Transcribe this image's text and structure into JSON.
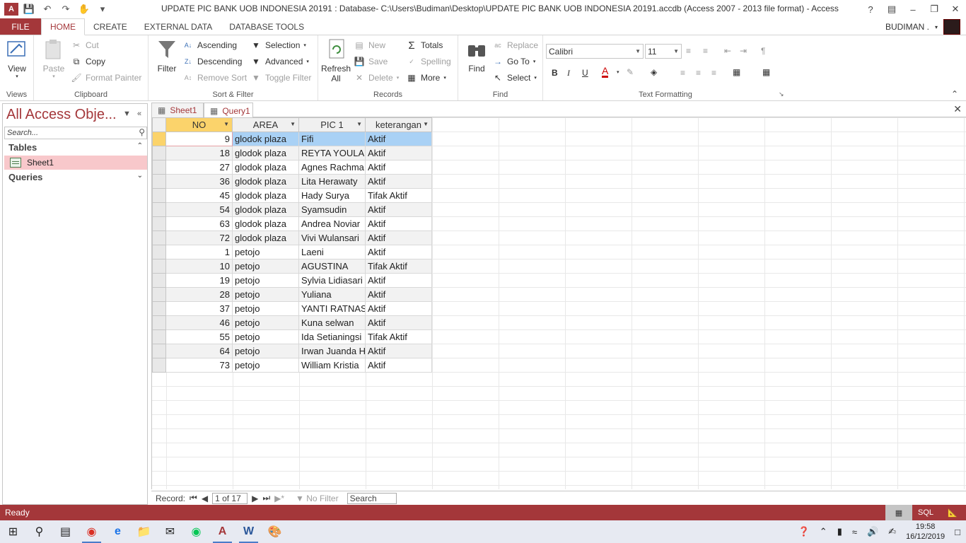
{
  "window": {
    "title": "UPDATE PIC BANK UOB INDONESIA 20191 : Database- C:\\Users\\Budiman\\Desktop\\UPDATE PIC BANK UOB INDONESIA 20191.accdb (Access 2007 - 2013 file format) - Access",
    "help": "?",
    "user": "BUDIMAN ."
  },
  "tabs": [
    "FILE",
    "HOME",
    "CREATE",
    "EXTERNAL DATA",
    "DATABASE TOOLS"
  ],
  "ribbon": {
    "views": {
      "label": "Views",
      "view": "View"
    },
    "clipboard": {
      "label": "Clipboard",
      "paste": "Paste",
      "cut": "Cut",
      "copy": "Copy",
      "format_painter": "Format Painter"
    },
    "sort_filter": {
      "label": "Sort & Filter",
      "filter": "Filter",
      "ascending": "Ascending",
      "descending": "Descending",
      "remove_sort": "Remove Sort",
      "selection": "Selection",
      "advanced": "Advanced",
      "toggle_filter": "Toggle Filter"
    },
    "records": {
      "label": "Records",
      "refresh": "Refresh",
      "refresh_sub": "All",
      "new": "New",
      "save": "Save",
      "delete": "Delete",
      "totals": "Totals",
      "spelling": "Spelling",
      "more": "More"
    },
    "find": {
      "label": "Find",
      "find": "Find",
      "replace": "Replace",
      "goto": "Go To",
      "select": "Select"
    },
    "text_formatting": {
      "label": "Text Formatting",
      "font": "Calibri",
      "size": "11",
      "bold": "B",
      "italic": "I",
      "underline": "U"
    }
  },
  "nav": {
    "title": "All Access Obje...",
    "search_placeholder": "Search...",
    "sections": [
      {
        "label": "Tables",
        "items": [
          "Sheet1"
        ]
      },
      {
        "label": "Queries",
        "items": []
      }
    ]
  },
  "doc_tabs": [
    "Sheet1",
    "Query1"
  ],
  "datasheet": {
    "columns": [
      "NO",
      "AREA",
      "PIC 1",
      "keterangan"
    ],
    "rows": [
      [
        "9",
        "glodok plaza",
        "Fifi",
        "Aktif"
      ],
      [
        "18",
        "glodok plaza",
        "REYTA YOULA H",
        "Aktif"
      ],
      [
        "27",
        "glodok plaza",
        "Agnes Rachma",
        "Aktif"
      ],
      [
        "36",
        "glodok plaza",
        "Lita Herawaty",
        "Aktif"
      ],
      [
        "45",
        "glodok plaza",
        "Hady Surya",
        "Tifak Aktif"
      ],
      [
        "54",
        "glodok plaza",
        "Syamsudin",
        "Aktif"
      ],
      [
        "63",
        "glodok plaza",
        "Andrea Noviar",
        "Aktif"
      ],
      [
        "72",
        "glodok plaza",
        "Vivi Wulansari",
        "Aktif"
      ],
      [
        "1",
        "petojo",
        "Laeni",
        "Aktif"
      ],
      [
        "10",
        "petojo",
        "AGUSTINA",
        "Tifak Aktif"
      ],
      [
        "19",
        "petojo",
        "Sylvia Lidiasari",
        "Aktif"
      ],
      [
        "28",
        "petojo",
        "Yuliana",
        "Aktif"
      ],
      [
        "37",
        "petojo",
        "YANTI RATNAS",
        "Aktif"
      ],
      [
        "46",
        "petojo",
        "Kuna selwan",
        "Aktif"
      ],
      [
        "55",
        "petojo",
        "Ida Setianingsi",
        "Tifak Aktif"
      ],
      [
        "64",
        "petojo",
        "Irwan Juanda H",
        "Aktif"
      ],
      [
        "73",
        "petojo",
        "William Kristia",
        "Aktif"
      ]
    ]
  },
  "record_nav": {
    "label": "Record:",
    "position": "1 of 17",
    "filter": "No Filter",
    "search": "Search"
  },
  "status": {
    "text": "Ready",
    "view1": "",
    "view2": "SQL"
  },
  "clock": {
    "time": "19:58",
    "date": "16/12/2019"
  },
  "colors": {
    "accent": "#a4373a",
    "header_selected": "#fbd36b",
    "row_selected": "#a9d1f5",
    "nav_selected": "#f8c8cb"
  }
}
